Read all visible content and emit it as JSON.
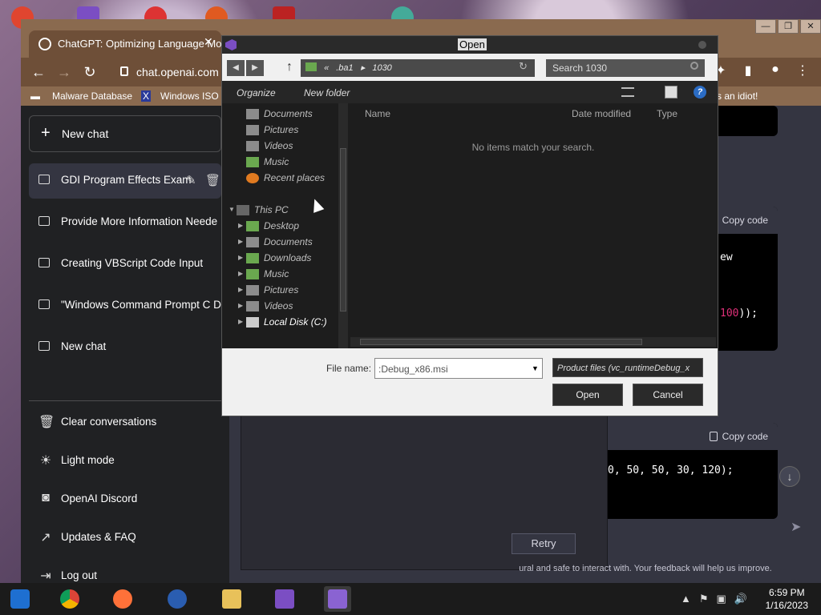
{
  "browser": {
    "tab_title": "ChatGPT: Optimizing Language Mo",
    "url": "chat.openai.com",
    "bookmarks": [
      "Malware Database",
      "Windows ISO",
      "s an idiot!"
    ]
  },
  "sidebar": {
    "new_chat_label": "New chat",
    "chats": [
      {
        "label": "GDI Program Effects Exam"
      },
      {
        "label": "Provide More Information Neede"
      },
      {
        "label": "Creating VBScript Code Input"
      },
      {
        "label": "\"Windows Command Prompt C D"
      },
      {
        "label": "New chat"
      }
    ],
    "actions": [
      {
        "label": "Clear conversations",
        "icon": "trash-icon"
      },
      {
        "label": "Light mode",
        "icon": "sun-icon"
      },
      {
        "label": "OpenAI Discord",
        "icon": "discord-icon"
      },
      {
        "label": "Updates & FAQ",
        "icon": "external-link-icon"
      },
      {
        "label": "Log out",
        "icon": "logout-icon"
      }
    ]
  },
  "main": {
    "copy_code_1": "Copy code",
    "code_1_line1": "ew",
    "code_1_line2_num": "100",
    "code_1_line2_rest": "));",
    "copy_code_2": "Copy code",
    "code_2_line": "0, 50, 50, 30, 120);",
    "retry_label": "Retry",
    "disclaimer": "ural and safe to interact with. Your feedback will help us improve."
  },
  "dialog": {
    "title": "Open",
    "path_prefix": "«",
    "path_1": ".ba1",
    "path_2": "1030",
    "search_placeholder": "Search 1030",
    "organize_label": "Organize",
    "new_folder_label": "New folder",
    "nav_items": [
      {
        "label": "Documents"
      },
      {
        "label": "Pictures"
      },
      {
        "label": "Videos"
      },
      {
        "label": "Music"
      },
      {
        "label": "Recent places"
      },
      {
        "label": "This PC"
      },
      {
        "label": "Desktop"
      },
      {
        "label": "Documents"
      },
      {
        "label": "Downloads"
      },
      {
        "label": "Music"
      },
      {
        "label": "Pictures"
      },
      {
        "label": "Videos"
      },
      {
        "label": "Local Disk (C:)"
      }
    ],
    "columns": [
      "Name",
      "Date modified",
      "Type"
    ],
    "empty_message": "No items match your search.",
    "file_name_label": "File name:",
    "file_name_value": ":Debug_x86.msi",
    "file_type": "Product files (vc_runtimeDebug_x",
    "open_button": "Open",
    "cancel_button": "Cancel"
  },
  "taskbar": {
    "time": "6:59 PM",
    "date": "1/16/2023"
  },
  "colors": {
    "sidebar_bg": "#202123",
    "chat_bg": "#343541",
    "code_number": "#df3079"
  }
}
